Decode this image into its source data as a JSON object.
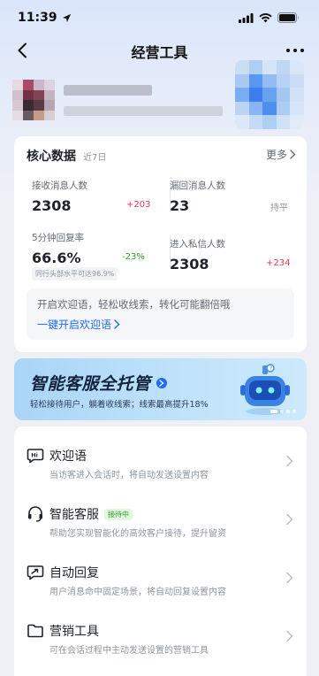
{
  "status_bar": {
    "time": "11:39"
  },
  "nav": {
    "title": "经营工具"
  },
  "core": {
    "title": "核心数据",
    "period": "近7日",
    "more": "更多",
    "metrics": [
      {
        "label": "接收消息人数",
        "value": "2308",
        "delta": "+203"
      },
      {
        "label": "漏回消息人数",
        "value": "23",
        "delta": "持平"
      },
      {
        "label": "5分钟回复率",
        "value": "66.6%",
        "delta": "-23%",
        "compare": "同行头部水平可达96.9%"
      },
      {
        "label": "进入私信人数",
        "value": "2308",
        "delta": "+234"
      }
    ],
    "tip_text": "开启欢迎语，轻松收线索，转化可能翻倍哦",
    "tip_link": "一键开启欢迎语"
  },
  "banner": {
    "title": "智能客服全托管",
    "subtitle": "轻松接待用户，躺着收线索；线索最高提升18%"
  },
  "tools": [
    {
      "title": "欢迎语",
      "desc": "当访客进入会话时，将自动发送设置内容",
      "icon": "hi-chat-icon"
    },
    {
      "title": "智能客服",
      "badge": "接待中",
      "desc": "帮助您实现智能化的高效客户接待，提升留资",
      "icon": "headset-icon"
    },
    {
      "title": "自动回复",
      "desc": "用户消息命中固定场景，将自动回复设置内容",
      "icon": "auto-reply-icon"
    },
    {
      "title": "营销工具",
      "desc": "可在会话过程中主动发送设置的营销工具",
      "icon": "folder-icon"
    }
  ],
  "colors": {
    "accent": "#1f6bff",
    "up": "#e8384f",
    "down": "#2ea121"
  }
}
